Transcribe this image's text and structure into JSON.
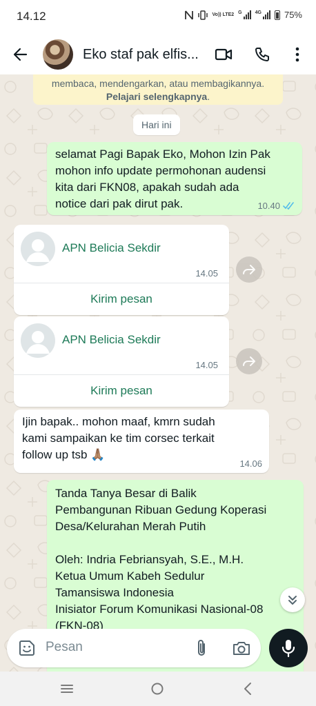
{
  "status_bar": {
    "time": "14.12",
    "volte_label": "Vo)) LTE2",
    "network_g": "G",
    "network_4g": "4G",
    "battery": "75%"
  },
  "header": {
    "contact_name": "Eko staf pak elfis..."
  },
  "encryption_notice": {
    "text": "membaca, mendengarkan, atau membagikannya.",
    "link": "Pelajari selengkapnya",
    "trailing": "."
  },
  "date_chip": "Hari ini",
  "messages": [
    {
      "text": "selamat Pagi Bapak Eko, Mohon Izin Pak\nmohon info update permohonan audensi\nkita dari FKN08, apakah sudah ada\nnotice dari pak dirut pak.",
      "time": "10.40"
    },
    {
      "text": "Ijin bapak.. mohon maaf, kmrn sudah\nkami sampaikan ke tim corsec terkait\nfollow up tsb 🙏🏽",
      "time": "14.06"
    },
    {
      "text": "Tanda Tanya Besar di Balik\nPembangunan Ribuan Gedung Koperasi\nDesa/Kelurahan Merah Putih\n\nOleh: Indria Febriansyah, S.E., M.H.\nKetua Umum Kabeh Sedulur\nTamansiswa Indonesia\nInisiator Forum Komunikasi Nasional-08\n(FKN-08)"
    }
  ],
  "contact_cards": [
    {
      "name": "APN Belicia Sekdir",
      "time": "14.05",
      "action": "Kirim pesan"
    },
    {
      "name": "APN Belicia Sekdir",
      "time": "14.05",
      "action": "Kirim pesan"
    }
  ],
  "composer": {
    "placeholder": "Pesan"
  },
  "colors": {
    "outgoing_bubble": "#d9fdd3",
    "incoming_bubble": "#ffffff",
    "chat_background": "#efeae2",
    "accent_green": "#1d7a57",
    "read_tick": "#53bdeb"
  },
  "icons": [
    "back-arrow-icon",
    "video-call-icon",
    "phone-icon",
    "more-vert-icon",
    "forward-icon",
    "chevron-double-down-icon",
    "sticker-icon",
    "attach-icon",
    "camera-icon",
    "mic-icon",
    "nav-menu-icon",
    "nav-home-icon",
    "nav-back-icon"
  ]
}
